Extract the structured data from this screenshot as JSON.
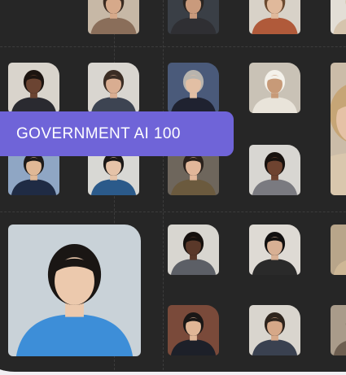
{
  "banner": {
    "title": "GOVERNMENT AI 100",
    "color": "#6f64d8"
  },
  "colors": {
    "background": "#f1eff3",
    "panel": "#262626"
  },
  "portraits": [
    {
      "name": "portrait-top-1",
      "bg": "#c7b8a6",
      "skin": "#d6a98a",
      "hair": "#3a2a20",
      "suit": "#8a6e5a"
    },
    {
      "name": "portrait-top-2",
      "bg": "#3a3f46",
      "skin": "#c99a7c",
      "hair": "#2a2420",
      "suit": "#2f2f33"
    },
    {
      "name": "portrait-top-3",
      "bg": "#d8d2c8",
      "skin": "#e0b99b",
      "hair": "#6b4a30",
      "suit": "#b05a3a"
    },
    {
      "name": "portrait-row2-1",
      "bg": "#d9d4cc",
      "skin": "#6b4432",
      "hair": "#1c1410",
      "suit": "#2a2a30"
    },
    {
      "name": "portrait-row2-2",
      "bg": "#d9d6d0",
      "skin": "#d9ad91",
      "hair": "#3b2d24",
      "suit": "#3d4452"
    },
    {
      "name": "portrait-row2-3",
      "bg": "#4a5a7a",
      "skin": "#e2bfa4",
      "hair": "#b8b4ae",
      "suit": "#1f2230"
    },
    {
      "name": "portrait-row2-4",
      "bg": "#c9c2b6",
      "skin": "#c79a78",
      "hair": "#f4f1ea",
      "suit": "#e9e4da"
    },
    {
      "name": "portrait-row3-1",
      "bg": "#8fa6c4",
      "skin": "#e0b896",
      "hair": "#1e1b1a",
      "suit": "#1f2b44"
    },
    {
      "name": "portrait-row3-2",
      "bg": "#d8d8d4",
      "skin": "#e6c3a8",
      "hair": "#1b1817",
      "suit": "#2b5a8a"
    },
    {
      "name": "portrait-row3-3",
      "bg": "#6e665c",
      "skin": "#e2b79a",
      "hair": "#2a211c",
      "suit": "#6b5a3e"
    },
    {
      "name": "portrait-row3-4",
      "bg": "#d8d6d2",
      "skin": "#6e4330",
      "hair": "#18120f",
      "suit": "#7a7a80"
    },
    {
      "name": "portrait-large",
      "bg": "#c9d2d8",
      "skin": "#ecc9ad",
      "hair": "#1a1614",
      "suit": "#3d8ed8"
    },
    {
      "name": "portrait-row4-2",
      "bg": "#d8d6d0",
      "skin": "#5a3829",
      "hair": "#15100d",
      "suit": "#5c5f66"
    },
    {
      "name": "portrait-row4-3",
      "bg": "#dedad4",
      "skin": "#d8b094",
      "hair": "#121010",
      "suit": "#2a2a2a"
    },
    {
      "name": "portrait-row5-2",
      "bg": "#7a4a3a",
      "skin": "#e0b696",
      "hair": "#1a1716",
      "suit": "#1d2029"
    },
    {
      "name": "portrait-row5-3",
      "bg": "#d9d5ce",
      "skin": "#d6a888",
      "hair": "#2e241d",
      "suit": "#3a4150"
    },
    {
      "name": "portrait-edge-1",
      "bg": "#cbbca8",
      "skin": "#e5c2a6",
      "hair": "#c6a576",
      "suit": "#d9c7ad"
    },
    {
      "name": "portrait-edge-2",
      "bg": "#b8a58a",
      "skin": "#e6c4a4",
      "hair": "#caa677",
      "suit": "#cdb796"
    },
    {
      "name": "portrait-edge-3",
      "bg": "#a99b8a",
      "skin": "#d9b394",
      "hair": "#3a2c22",
      "suit": "#6d5e50"
    },
    {
      "name": "portrait-edge-4",
      "bg": "#e3ded6",
      "skin": "#e2bca0",
      "hair": "#c4a070",
      "suit": "#d5c4ad"
    }
  ]
}
